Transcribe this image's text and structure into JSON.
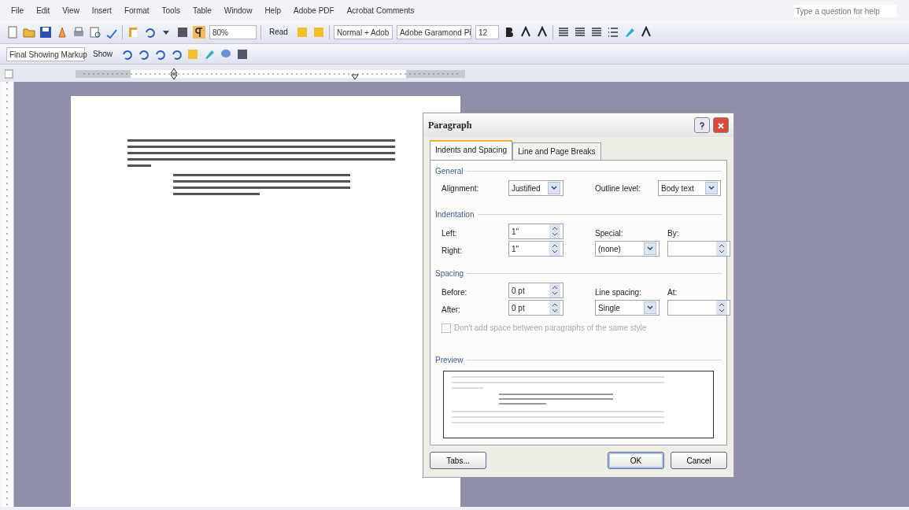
{
  "menu": [
    "File",
    "Edit",
    "View",
    "Insert",
    "Format",
    "Tools",
    "Table",
    "Window",
    "Help",
    "Adobe PDF",
    "Acrobat Comments"
  ],
  "help_box": {
    "placeholder": "Type a question for help"
  },
  "standard_toolbar": {
    "zoom": "80%",
    "read": "Read"
  },
  "formatting_toolbar": {
    "style": "Normal + Adob",
    "font": "Adobe Garamond Pi",
    "size": "12"
  },
  "reviewing_toolbar": {
    "display": "Final Showing Markup",
    "show": "Show"
  },
  "dialog": {
    "title": "Paragraph",
    "tabs": [
      {
        "label": "Indents and Spacing",
        "selected": true
      },
      {
        "label": "Line and Page Breaks",
        "selected": false
      }
    ],
    "general": {
      "heading": "General",
      "alignment_label": "Alignment:",
      "alignment": "Justified",
      "outline_label": "Outline level:",
      "outline": "Body text"
    },
    "indentation": {
      "heading": "Indentation",
      "left_label": "Left:",
      "left": "1\"",
      "right_label": "Right:",
      "right": "1\"",
      "special_label": "Special:",
      "special": "(none)",
      "by_label": "By:"
    },
    "spacing": {
      "heading": "Spacing",
      "before_label": "Before:",
      "before": "0 pt",
      "after_label": "After:",
      "after": "0 pt",
      "line_label": "Line spacing:",
      "line": "Single",
      "at_label": "At:"
    },
    "checkbox": {
      "label": "Don't add space between paragraphs of the same style",
      "checked": false,
      "disabled": true
    },
    "preview_heading": "Preview",
    "buttons": [
      {
        "label": "Tabs...",
        "kind": "left"
      },
      {
        "label": "OK",
        "kind": "default"
      },
      {
        "label": "Cancel",
        "kind": "normal"
      }
    ]
  }
}
